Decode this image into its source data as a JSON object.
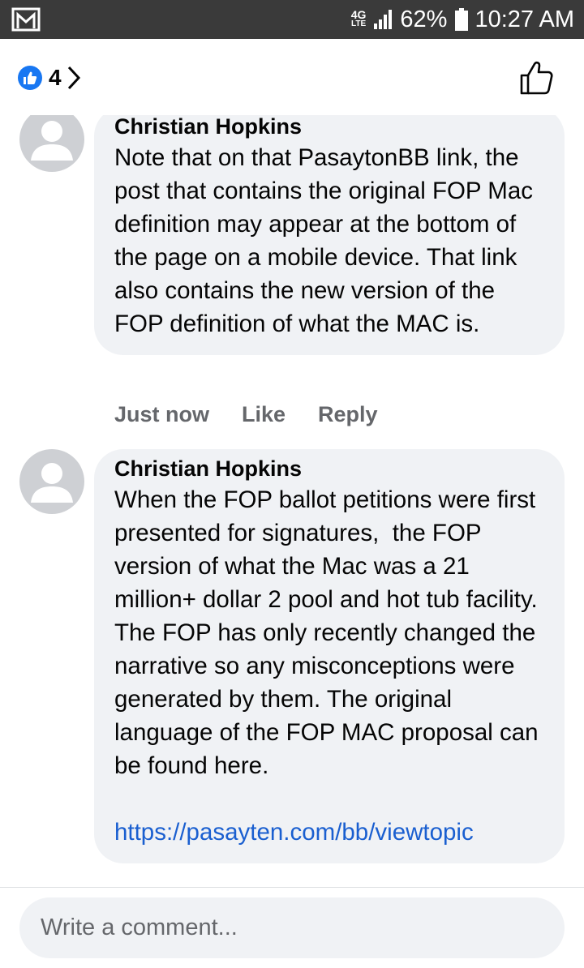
{
  "status_bar": {
    "network": "4G",
    "network_sub": "LTE",
    "battery": "62%",
    "time": "10:27 AM",
    "icons": [
      "gmail-icon",
      "signal-icon",
      "battery-icon"
    ]
  },
  "header": {
    "reaction_icon": "like-reaction-icon",
    "reaction_count": "4",
    "like_button_icon": "thumbs-up-outline-icon",
    "accent": "#1877f2"
  },
  "comments": [
    {
      "author": "Christian Hopkins",
      "text": "Note that on that PasaytonBB link, the post that contains the original FOP Mac definition may appear at the bottom of the page on a mobile device. That link also contains the new version of the FOP definition of what the MAC is.",
      "time": "Just now",
      "like_label": "Like",
      "reply_label": "Reply"
    },
    {
      "author": "Christian Hopkins",
      "text": "When the FOP ballot petitions were first presented for signatures,  the FOP version of what the Mac was a 21 million+ dollar 2 pool and hot tub facility. The FOP has only recently changed the narrative so any misconceptions were generated by them. The original language of the FOP MAC proposal can be found here.",
      "link": "https://pasayten.com/bb/viewtopic"
    }
  ],
  "composer": {
    "placeholder": "Write a comment..."
  }
}
